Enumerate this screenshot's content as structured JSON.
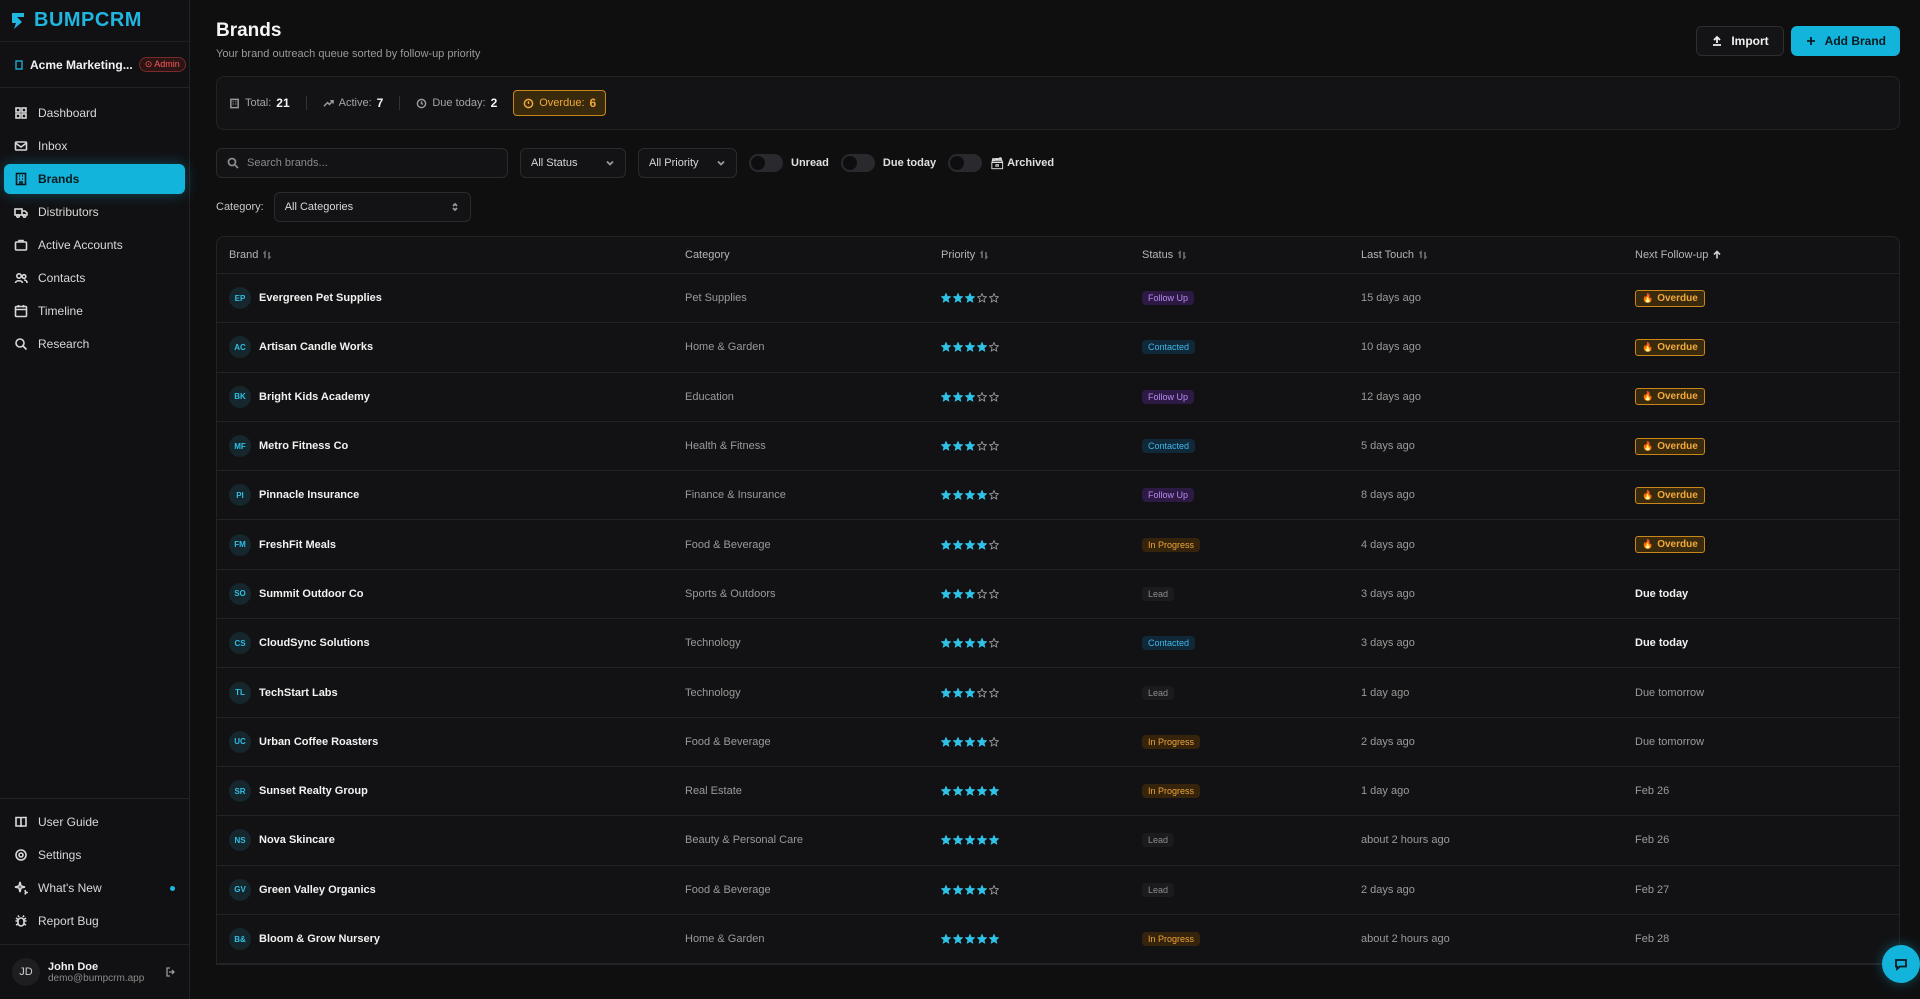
{
  "app": {
    "logo": "BUMPCRM"
  },
  "org": {
    "name": "Acme Marketing...",
    "badge": "Admin"
  },
  "nav": [
    {
      "label": "Dashboard",
      "icon": "grid-icon"
    },
    {
      "label": "Inbox",
      "icon": "mail-icon"
    },
    {
      "label": "Brands",
      "icon": "building-icon",
      "active": true
    },
    {
      "label": "Distributors",
      "icon": "truck-icon"
    },
    {
      "label": "Active Accounts",
      "icon": "briefcase-icon"
    },
    {
      "label": "Contacts",
      "icon": "users-icon"
    },
    {
      "label": "Timeline",
      "icon": "calendar-icon"
    },
    {
      "label": "Research",
      "icon": "search-icon"
    }
  ],
  "nav_bottom": [
    {
      "label": "User Guide",
      "icon": "book-icon"
    },
    {
      "label": "Settings",
      "icon": "gear-icon"
    },
    {
      "label": "What's New",
      "icon": "sparkle-icon"
    },
    {
      "label": "Report Bug",
      "icon": "bug-icon"
    }
  ],
  "user": {
    "initials": "JD",
    "name": "John Doe",
    "email": "demo@bumpcrm.app"
  },
  "page": {
    "title": "Brands",
    "subtitle": "Your brand outreach queue sorted by follow-up priority"
  },
  "actions": {
    "import": "Import",
    "add": "Add Brand"
  },
  "stats": {
    "total_label": "Total:",
    "total": "21",
    "active_label": "Active:",
    "active": "7",
    "due_label": "Due today:",
    "due": "2",
    "overdue_label": "Overdue:",
    "overdue": "6"
  },
  "filters": {
    "search_placeholder": "Search brands...",
    "status": "All Status",
    "priority": "All Priority",
    "unread": "Unread",
    "due_today": "Due today",
    "archived": "Archived",
    "category_label": "Category:",
    "category": "All Categories"
  },
  "colors": {
    "accent": "#13b4db",
    "overdue": "#f2a93b",
    "background": "#0f0f10"
  },
  "table": {
    "headers": [
      "Brand",
      "Category",
      "Priority",
      "Status",
      "Last Touch",
      "Next Follow-up"
    ],
    "rows": [
      {
        "initials": "EP",
        "brand": "Evergreen Pet Supplies",
        "category": "Pet Supplies",
        "priority": 3,
        "status": "Follow Up",
        "last": "15 days ago",
        "next": "Overdue",
        "next_type": "overdue"
      },
      {
        "initials": "AC",
        "brand": "Artisan Candle Works",
        "category": "Home & Garden",
        "priority": 4,
        "status": "Contacted",
        "last": "10 days ago",
        "next": "Overdue",
        "next_type": "overdue"
      },
      {
        "initials": "BK",
        "brand": "Bright Kids Academy",
        "category": "Education",
        "priority": 3,
        "status": "Follow Up",
        "last": "12 days ago",
        "next": "Overdue",
        "next_type": "overdue"
      },
      {
        "initials": "MF",
        "brand": "Metro Fitness Co",
        "category": "Health & Fitness",
        "priority": 3,
        "status": "Contacted",
        "last": "5 days ago",
        "next": "Overdue",
        "next_type": "overdue"
      },
      {
        "initials": "PI",
        "brand": "Pinnacle Insurance",
        "category": "Finance & Insurance",
        "priority": 4,
        "status": "Follow Up",
        "last": "8 days ago",
        "next": "Overdue",
        "next_type": "overdue"
      },
      {
        "initials": "FM",
        "brand": "FreshFit Meals",
        "category": "Food & Beverage",
        "priority": 4,
        "status": "In Progress",
        "last": "4 days ago",
        "next": "Overdue",
        "next_type": "overdue"
      },
      {
        "initials": "SO",
        "brand": "Summit Outdoor Co",
        "category": "Sports & Outdoors",
        "priority": 3,
        "status": "Lead",
        "last": "3 days ago",
        "next": "Due today",
        "next_type": "today"
      },
      {
        "initials": "CS",
        "brand": "CloudSync Solutions",
        "category": "Technology",
        "priority": 4,
        "status": "Contacted",
        "last": "3 days ago",
        "next": "Due today",
        "next_type": "today"
      },
      {
        "initials": "TL",
        "brand": "TechStart Labs",
        "category": "Technology",
        "priority": 3,
        "status": "Lead",
        "last": "1 day ago",
        "next": "Due tomorrow",
        "next_type": "normal"
      },
      {
        "initials": "UC",
        "brand": "Urban Coffee Roasters",
        "category": "Food & Beverage",
        "priority": 4,
        "status": "In Progress",
        "last": "2 days ago",
        "next": "Due tomorrow",
        "next_type": "normal"
      },
      {
        "initials": "SR",
        "brand": "Sunset Realty Group",
        "category": "Real Estate",
        "priority": 5,
        "status": "In Progress",
        "last": "1 day ago",
        "next": "Feb 26",
        "next_type": "normal"
      },
      {
        "initials": "NS",
        "brand": "Nova Skincare",
        "category": "Beauty & Personal Care",
        "priority": 5,
        "status": "Lead",
        "last": "about 2 hours ago",
        "next": "Feb 26",
        "next_type": "normal"
      },
      {
        "initials": "GV",
        "brand": "Green Valley Organics",
        "category": "Food & Beverage",
        "priority": 4,
        "status": "Lead",
        "last": "2 days ago",
        "next": "Feb 27",
        "next_type": "normal"
      },
      {
        "initials": "B&",
        "brand": "Bloom & Grow Nursery",
        "category": "Home & Garden",
        "priority": 5,
        "status": "In Progress",
        "last": "about 2 hours ago",
        "next": "Feb 28",
        "next_type": "normal"
      }
    ]
  }
}
